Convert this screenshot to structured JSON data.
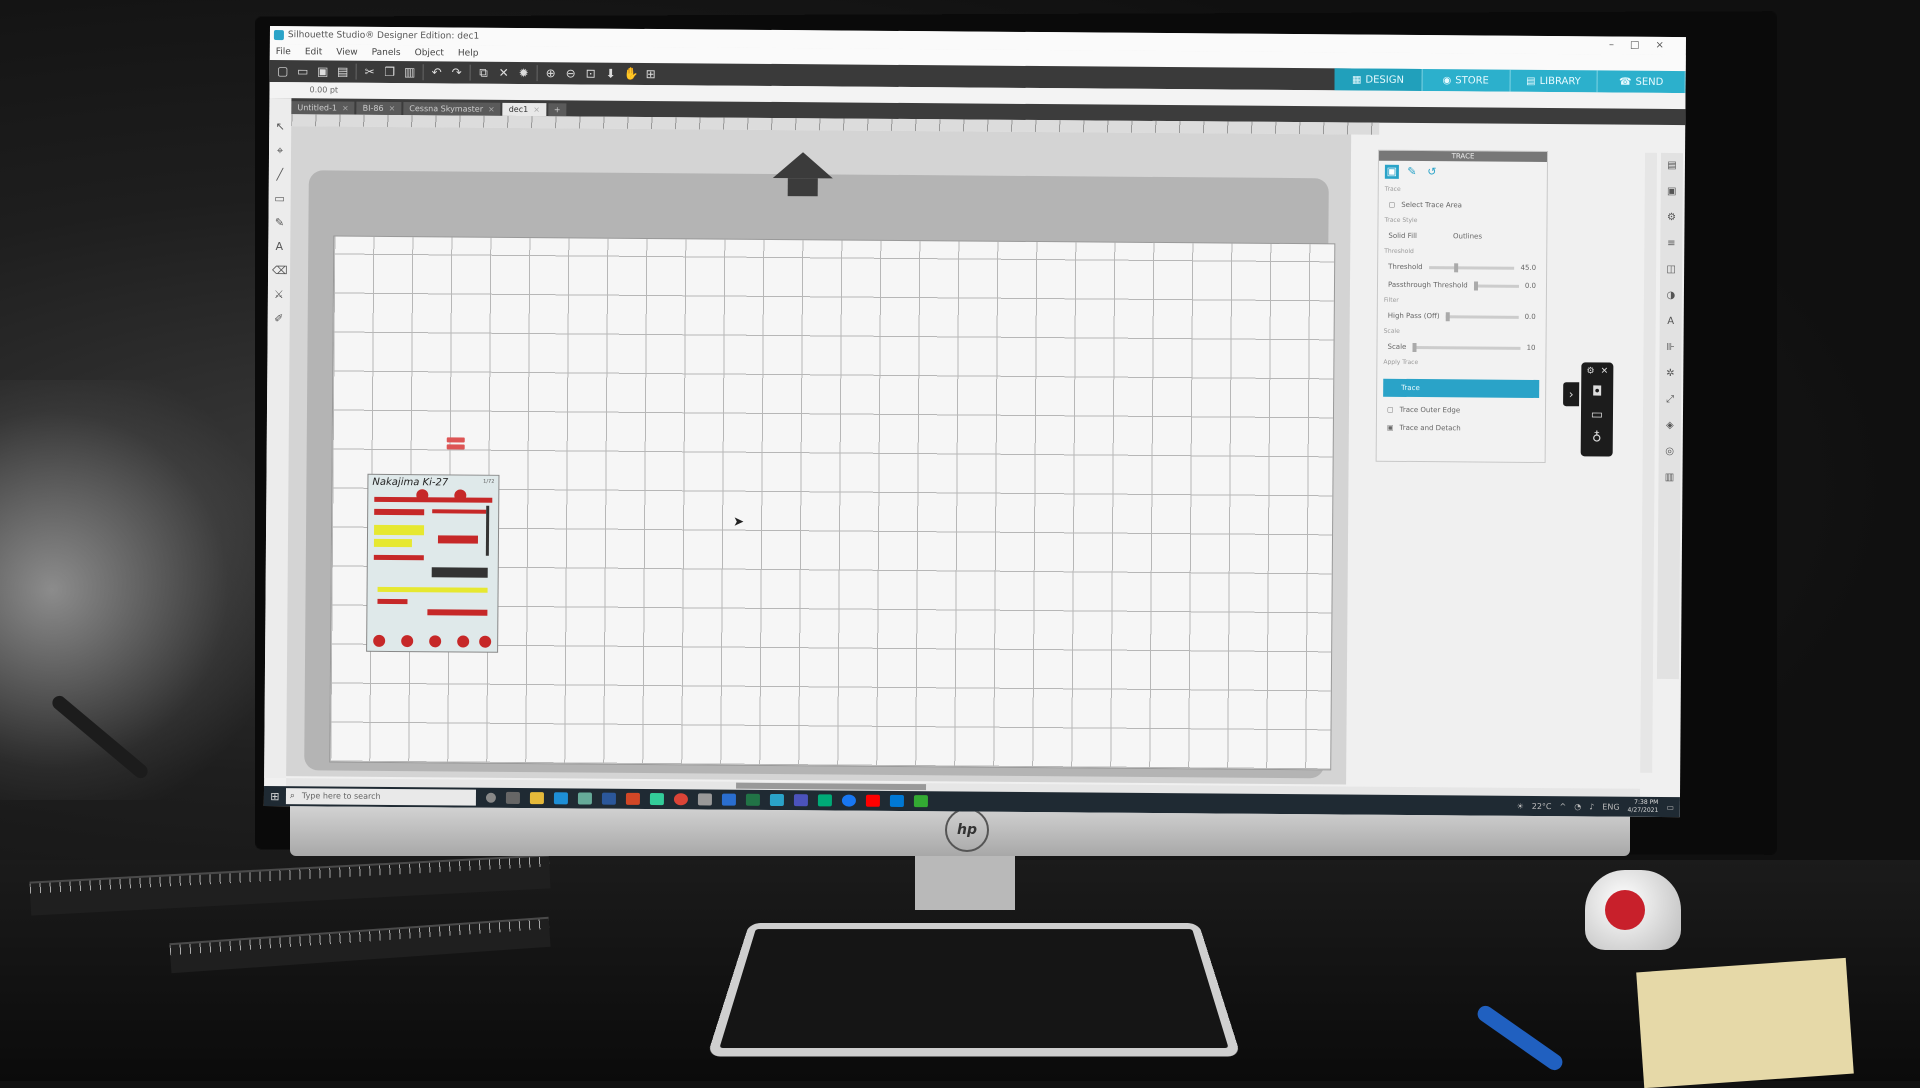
{
  "window": {
    "title": "Silhouette Studio® Designer Edition: dec1",
    "controls": [
      "–",
      "□",
      "×"
    ]
  },
  "menu": [
    "File",
    "Edit",
    "View",
    "Panels",
    "Object",
    "Help"
  ],
  "toolbar": {
    "icons": [
      "new-icon",
      "open-icon",
      "save-icon",
      "print-icon",
      "cut-icon",
      "copy-icon",
      "paste-icon",
      "undo-icon",
      "redo-icon",
      "group-icon",
      "ungroup-icon",
      "zoom-in-icon",
      "zoom-out-icon",
      "zoom-fit-icon",
      "pan-down-icon",
      "hand-icon",
      "fit-page-icon"
    ]
  },
  "options_bar": {
    "line_value": "0.00",
    "unit": "pt"
  },
  "modes": [
    {
      "label": "DESIGN",
      "icon": "design-icon"
    },
    {
      "label": "STORE",
      "icon": "store-icon"
    },
    {
      "label": "LIBRARY",
      "icon": "library-icon"
    },
    {
      "label": "SEND",
      "icon": "send-icon"
    }
  ],
  "doc_tabs": [
    "Untitled-1",
    "BI-86",
    "Cessna Skymaster",
    "dec1"
  ],
  "decal_sheet": {
    "title": "Nakajima Ki-27",
    "scale": "1/72"
  },
  "trace_panel": {
    "header": "TRACE",
    "section_trace": "Trace",
    "select_area": "Select Trace Area",
    "trace_style": "Trace Style",
    "solid_fill": "Solid Fill",
    "outlines": "Outlines",
    "threshold_sec": "Threshold",
    "threshold": "Threshold",
    "threshold_value": "45.0",
    "passthrough": "Passthrough Threshold",
    "passthrough_value": "0.0",
    "filter_sec": "Filter",
    "highpass": "High Pass (Off)",
    "highpass_value": "0.0",
    "scale_sec": "Scale",
    "scale": "Scale",
    "scale_value": "10",
    "apply_sec": "Apply Trace",
    "btn_trace": "Trace",
    "btn_outer": "Trace Outer Edge",
    "btn_detach": "Trace and Detach"
  },
  "taskbar": {
    "search_placeholder": "Type here to search",
    "temperature": "22°C",
    "lang": "ENG",
    "time": "7:38 PM",
    "date": "4/27/2021"
  },
  "colors": {
    "accent": "#2aa3c8",
    "toolbar": "#3a3a3a",
    "decal_red": "#c62828",
    "decal_yellow": "#e6e830"
  }
}
